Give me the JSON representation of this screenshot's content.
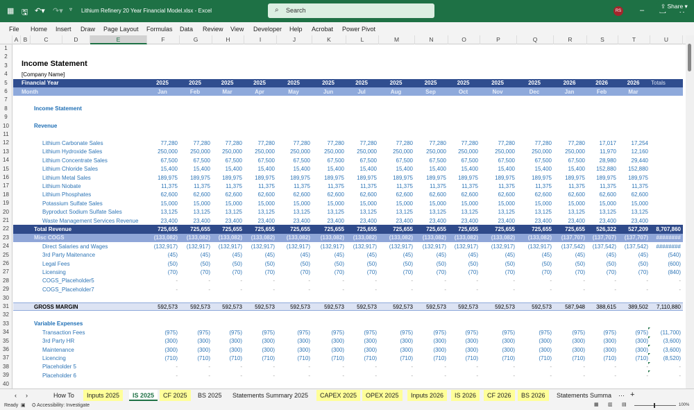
{
  "title_bar": {
    "doc_title": "Lithium Refinery 20 Year Financial Model.xlsx  -  Excel",
    "search_placeholder": "Search",
    "avatar": "RS",
    "brand_color": "#1E7145"
  },
  "menu": [
    "File",
    "Home",
    "Insert",
    "Draw",
    "Page Layout",
    "Formulas",
    "Data",
    "Review",
    "View",
    "Developer",
    "Help",
    "Acrobat",
    "Power Pivot"
  ],
  "share_label": "Share",
  "columns": [
    "A",
    "B",
    "C",
    "D",
    "E",
    "F",
    "G",
    "H",
    "I",
    "J",
    "K",
    "L",
    "M",
    "N",
    "O",
    "P",
    "Q",
    "R",
    "S",
    "T",
    "U"
  ],
  "selected_column": "E",
  "sheet": {
    "title": "Income Statement",
    "company": "[Company Name]",
    "fy_label": "Financial Year",
    "month_label": "Month",
    "years": [
      "2025",
      "2025",
      "2025",
      "2025",
      "2025",
      "2025",
      "2025",
      "2025",
      "2025",
      "2025",
      "2025",
      "2025",
      "2026",
      "2026",
      "2026"
    ],
    "months": [
      "Jan",
      "Feb",
      "Mar",
      "Apr",
      "May",
      "Jun",
      "Jul",
      "Aug",
      "Sep",
      "Oct",
      "Nov",
      "Dec",
      "Jan",
      "Feb",
      "Mar"
    ],
    "totals_label": "Totals",
    "section_income": "Income Statement",
    "section_revenue": "Revenue",
    "section_variable": "Variable Expenses",
    "rows": [
      {
        "n": 12,
        "label": "Lithium Carbonate Sales",
        "type": "item",
        "values": [
          "77,280",
          "77,280",
          "77,280",
          "77,280",
          "77,280",
          "77,280",
          "77,280",
          "77,280",
          "77,280",
          "77,280",
          "77,280",
          "77,280",
          "77,280",
          "17,017",
          "17,254"
        ],
        "total": ""
      },
      {
        "n": 13,
        "label": "Lithium Hydroxide Sales",
        "type": "item",
        "values": [
          "250,000",
          "250,000",
          "250,000",
          "250,000",
          "250,000",
          "250,000",
          "250,000",
          "250,000",
          "250,000",
          "250,000",
          "250,000",
          "250,000",
          "250,000",
          "11,970",
          "12,160"
        ],
        "total": ""
      },
      {
        "n": 14,
        "label": "Lithium Concentrate Sales",
        "type": "item",
        "values": [
          "67,500",
          "67,500",
          "67,500",
          "67,500",
          "67,500",
          "67,500",
          "67,500",
          "67,500",
          "67,500",
          "67,500",
          "67,500",
          "67,500",
          "67,500",
          "28,980",
          "29,440"
        ],
        "total": ""
      },
      {
        "n": 15,
        "label": "Lithium Chloride Sales",
        "type": "item",
        "values": [
          "15,400",
          "15,400",
          "15,400",
          "15,400",
          "15,400",
          "15,400",
          "15,400",
          "15,400",
          "15,400",
          "15,400",
          "15,400",
          "15,400",
          "15,400",
          "152,880",
          "152,880"
        ],
        "total": ""
      },
      {
        "n": 16,
        "label": "Lithium Metal Sales",
        "type": "item",
        "values": [
          "189,975",
          "189,975",
          "189,975",
          "189,975",
          "189,975",
          "189,975",
          "189,975",
          "189,975",
          "189,975",
          "189,975",
          "189,975",
          "189,975",
          "189,975",
          "189,975",
          "189,975"
        ],
        "total": ""
      },
      {
        "n": 17,
        "label": "Lithium Niobate",
        "type": "item",
        "values": [
          "11,375",
          "11,375",
          "11,375",
          "11,375",
          "11,375",
          "11,375",
          "11,375",
          "11,375",
          "11,375",
          "11,375",
          "11,375",
          "11,375",
          "11,375",
          "11,375",
          "11,375"
        ],
        "total": ""
      },
      {
        "n": 18,
        "label": "Lithium Phosphates",
        "type": "item",
        "values": [
          "62,600",
          "62,600",
          "62,600",
          "62,600",
          "62,600",
          "62,600",
          "62,600",
          "62,600",
          "62,600",
          "62,600",
          "62,600",
          "62,600",
          "62,600",
          "62,600",
          "62,600"
        ],
        "total": ""
      },
      {
        "n": 19,
        "label": "Potassium Sulfate Sales",
        "type": "item",
        "values": [
          "15,000",
          "15,000",
          "15,000",
          "15,000",
          "15,000",
          "15,000",
          "15,000",
          "15,000",
          "15,000",
          "15,000",
          "15,000",
          "15,000",
          "15,000",
          "15,000",
          "15,000"
        ],
        "total": ""
      },
      {
        "n": 20,
        "label": "Byproduct Sodium Sulfate Sales",
        "type": "item",
        "values": [
          "13,125",
          "13,125",
          "13,125",
          "13,125",
          "13,125",
          "13,125",
          "13,125",
          "13,125",
          "13,125",
          "13,125",
          "13,125",
          "13,125",
          "13,125",
          "13,125",
          "13,125"
        ],
        "total": ""
      },
      {
        "n": 21,
        "label": "Waste Management Services Revenue",
        "type": "item",
        "values": [
          "23,400",
          "23,400",
          "23,400",
          "23,400",
          "23,400",
          "23,400",
          "23,400",
          "23,400",
          "23,400",
          "23,400",
          "23,400",
          "23,400",
          "23,400",
          "23,400",
          "23,400"
        ],
        "total": ""
      },
      {
        "n": 22,
        "label": "Total Revenue",
        "type": "total",
        "values": [
          "725,655",
          "725,655",
          "725,655",
          "725,655",
          "725,655",
          "725,655",
          "725,655",
          "725,655",
          "725,655",
          "725,655",
          "725,655",
          "725,655",
          "725,655",
          "526,322",
          "527,209"
        ],
        "total": "8,707,860"
      },
      {
        "n": 23,
        "label": "Misc COGS",
        "type": "subtotal",
        "values": [
          "(133,082)",
          "(133,082)",
          "(133,082)",
          "(133,082)",
          "(133,082)",
          "(133,082)",
          "(133,082)",
          "(133,082)",
          "(133,082)",
          "(133,082)",
          "(133,082)",
          "(133,082)",
          "(137,707)",
          "(137,707)",
          "(137,707)"
        ],
        "total": "########"
      },
      {
        "n": 24,
        "label": "Direct Salaries and Wages",
        "type": "item",
        "values": [
          "(132,917)",
          "(132,917)",
          "(132,917)",
          "(132,917)",
          "(132,917)",
          "(132,917)",
          "(132,917)",
          "(132,917)",
          "(132,917)",
          "(132,917)",
          "(132,917)",
          "(132,917)",
          "(137,542)",
          "(137,542)",
          "(137,542)"
        ],
        "total": "########"
      },
      {
        "n": 25,
        "label": "3rd Party Maitenance",
        "type": "item",
        "values": [
          "(45)",
          "(45)",
          "(45)",
          "(45)",
          "(45)",
          "(45)",
          "(45)",
          "(45)",
          "(45)",
          "(45)",
          "(45)",
          "(45)",
          "(45)",
          "(45)",
          "(45)"
        ],
        "total": "(540)"
      },
      {
        "n": 26,
        "label": "Legal Fees",
        "type": "item",
        "values": [
          "(50)",
          "(50)",
          "(50)",
          "(50)",
          "(50)",
          "(50)",
          "(50)",
          "(50)",
          "(50)",
          "(50)",
          "(50)",
          "(50)",
          "(50)",
          "(50)",
          "(50)"
        ],
        "total": "(600)"
      },
      {
        "n": 27,
        "label": "Licensing",
        "type": "item",
        "values": [
          "(70)",
          "(70)",
          "(70)",
          "(70)",
          "(70)",
          "(70)",
          "(70)",
          "(70)",
          "(70)",
          "(70)",
          "(70)",
          "(70)",
          "(70)",
          "(70)",
          "(70)"
        ],
        "total": "(840)"
      },
      {
        "n": 28,
        "label": "COGS_Placeholder5",
        "type": "item",
        "values": [
          "-",
          "-",
          "-",
          "-",
          "-",
          "-",
          "-",
          "-",
          "-",
          "-",
          "-",
          "-",
          "-",
          "-",
          "-"
        ],
        "total": "-"
      },
      {
        "n": 29,
        "label": "COGS_Placeholder7",
        "type": "item",
        "values": [
          "-",
          "-",
          "-",
          "-",
          "-",
          "-",
          "-",
          "-",
          "-",
          "-",
          "-",
          "-",
          "-",
          "-",
          "-"
        ],
        "total": "-"
      },
      {
        "n": 31,
        "label": "GROSS MARGIN",
        "type": "margin",
        "values": [
          "592,573",
          "592,573",
          "592,573",
          "592,573",
          "592,573",
          "592,573",
          "592,573",
          "592,573",
          "592,573",
          "592,573",
          "592,573",
          "592,573",
          "587,948",
          "388,615",
          "389,502"
        ],
        "total": "7,110,880"
      },
      {
        "n": 34,
        "label": "Transaction Fees",
        "type": "item",
        "values": [
          "(975)",
          "(975)",
          "(975)",
          "(975)",
          "(975)",
          "(975)",
          "(975)",
          "(975)",
          "(975)",
          "(975)",
          "(975)",
          "(975)",
          "(975)",
          "(975)",
          "(975)"
        ],
        "total": "(11,700)"
      },
      {
        "n": 35,
        "label": "3rd Party HR",
        "type": "item",
        "values": [
          "(300)",
          "(300)",
          "(300)",
          "(300)",
          "(300)",
          "(300)",
          "(300)",
          "(300)",
          "(300)",
          "(300)",
          "(300)",
          "(300)",
          "(300)",
          "(300)",
          "(300)"
        ],
        "total": "(3,600)"
      },
      {
        "n": 36,
        "label": "Maintenance",
        "type": "item",
        "values": [
          "(300)",
          "(300)",
          "(300)",
          "(300)",
          "(300)",
          "(300)",
          "(300)",
          "(300)",
          "(300)",
          "(300)",
          "(300)",
          "(300)",
          "(300)",
          "(300)",
          "(300)"
        ],
        "total": "(3,600)"
      },
      {
        "n": 37,
        "label": "Licencing",
        "type": "item",
        "values": [
          "(710)",
          "(710)",
          "(710)",
          "(710)",
          "(710)",
          "(710)",
          "(710)",
          "(710)",
          "(710)",
          "(710)",
          "(710)",
          "(710)",
          "(710)",
          "(710)",
          "(710)"
        ],
        "total": "(8,520)"
      },
      {
        "n": 38,
        "label": "Placeholder 5",
        "type": "item",
        "values": [
          "-",
          "-",
          "-",
          "-",
          "-",
          "-",
          "-",
          "-",
          "-",
          "-",
          "-",
          "-",
          "-",
          "-",
          "-"
        ],
        "total": "-"
      },
      {
        "n": 39,
        "label": "Placeholder 6",
        "type": "item",
        "values": [
          "-",
          "-",
          "-",
          "-",
          "-",
          "-",
          "-",
          "-",
          "-",
          "-",
          "-",
          "-",
          "-",
          "-",
          "-"
        ],
        "total": "-"
      }
    ]
  },
  "tabs": [
    {
      "label": "How To",
      "style": "plain"
    },
    {
      "label": "Inputs 2025",
      "style": "yellow"
    },
    {
      "label": "IS 2025",
      "style": "active"
    },
    {
      "label": "CF 2025",
      "style": "yellow"
    },
    {
      "label": "BS 2025",
      "style": "plain"
    },
    {
      "label": "Statements Summary 2025",
      "style": "plain"
    },
    {
      "label": "CAPEX 2025",
      "style": "yellow"
    },
    {
      "label": "OPEX 2025",
      "style": "yellow"
    },
    {
      "label": "Inputs 2026",
      "style": "yellow"
    },
    {
      "label": "IS 2026",
      "style": "yellow"
    },
    {
      "label": "CF 2026",
      "style": "yellow"
    },
    {
      "label": "BS 2026",
      "style": "yellow"
    },
    {
      "label": "Statements Summa",
      "style": "plain"
    }
  ],
  "status": {
    "ready": "Ready",
    "accessibility": "Accessibility: Investigate",
    "zoom": "100%"
  }
}
